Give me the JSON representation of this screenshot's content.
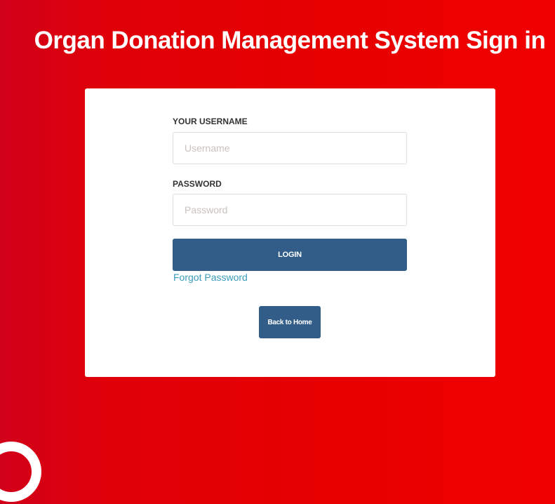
{
  "page": {
    "title": "Organ Donation Management System Sign in"
  },
  "form": {
    "username_label": "YOUR USERNAME",
    "username_placeholder": "Username",
    "username_value": "",
    "password_label": "PASSWORD",
    "password_placeholder": "Password",
    "password_value": "",
    "login_label": "LOGIN",
    "forgot_label": "Forgot Password",
    "back_label": "Back to Home"
  },
  "colors": {
    "background_left": "#d1001a",
    "background_right": "#f10000",
    "button": "#325d89",
    "link": "#3b9cbb"
  },
  "icons": {
    "corner": "ring-logo-icon"
  }
}
